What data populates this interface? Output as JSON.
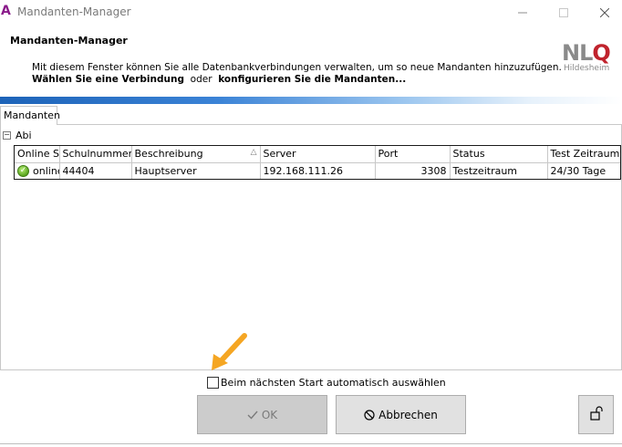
{
  "window": {
    "title": "Mandanten-Manager",
    "app_icon": "A",
    "controls": {
      "minimize": "—",
      "maximize": "☐",
      "close": "✕"
    }
  },
  "header": {
    "title": "Mandanten-Manager",
    "description": "Mit diesem Fenster können Sie alle Datenbankverbindungen verwalten, um so neue Mandanten hinzuzufügen.",
    "instruction_part1": "Wählen Sie eine Verbindung",
    "instruction_or": "oder",
    "instruction_part2": "konfigurieren Sie die Mandanten...",
    "logo_main_text": "NL",
    "logo_q": "Q",
    "logo_sub": "Hildesheim",
    "accent_color": "#1d63b8",
    "logo_red": "#c0232d"
  },
  "tabs": [
    {
      "label": "Mandanten",
      "active": true
    }
  ],
  "group": {
    "toggle": "−",
    "label": "Abi"
  },
  "table": {
    "columns": [
      "Online St",
      "Schulnummer",
      "Beschreibung",
      "Server",
      "Port",
      "Status",
      "Test Zeitraum"
    ],
    "sort_indicator": "△",
    "rows": [
      {
        "online": "online",
        "schulnummer": "44404",
        "beschreibung": "Hauptserver",
        "server": "192.168.111.26",
        "port": "3308",
        "status": "Testzeitraum",
        "test_zeitraum": "24/30 Tage"
      }
    ]
  },
  "footer": {
    "auto_select_label": "Beim nächsten Start automatisch auswählen",
    "auto_select_checked": false,
    "ok_label": "OK",
    "ok_enabled": false,
    "cancel_label": "Abbrechen"
  },
  "annotation_arrow_color": "#f5a623"
}
